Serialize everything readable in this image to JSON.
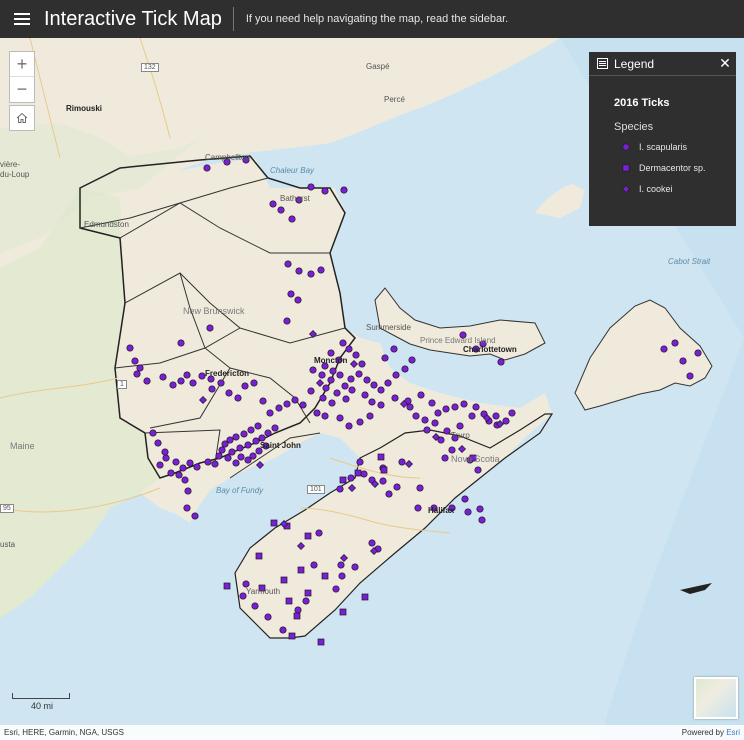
{
  "header": {
    "title": "Interactive Tick Map",
    "subtitle": "If you need help navigating the map, read the sidebar."
  },
  "controls": {
    "zoom_in": "+",
    "zoom_out": "−",
    "home_icon": "home-icon",
    "menu_icon": "hamburger-menu-icon"
  },
  "legend": {
    "title": "Legend",
    "layer": "2016 Ticks",
    "field": "Species",
    "items": [
      {
        "label": "I. scapularis",
        "symbol": "circle",
        "color": "#7b1fd6"
      },
      {
        "label": "Dermacentor sp.",
        "symbol": "square",
        "color": "#7b1fd6"
      },
      {
        "label": "I. cookei",
        "symbol": "diamond",
        "color": "#7b1fd6"
      }
    ]
  },
  "map_labels": {
    "gaspe": "Gaspé",
    "perce": "Percé",
    "rimouski": "Rimouski",
    "riviere1": "vière-",
    "riviere2": "du-Loup",
    "campbellton": "Campbellton",
    "bathurst": "Bathurst",
    "edmundston": "Edmundston",
    "new_brunswick": "New Brunswick",
    "fredericton": "Fredericton",
    "moncton": "Moncton",
    "saint_john": "Saint John",
    "summerside": "Summerside",
    "pei": "Prince Edward Island",
    "charlottetown": "Charlottetown",
    "truro": "Truro",
    "nova_scotia": "Nova Scotia",
    "halifax": "Halifax",
    "yarmouth": "Yarmouth",
    "maine": "Maine",
    "augusta": "usta",
    "chaleur_bay": "Chaleur Bay",
    "bay_of_fundy": "Bay of Fundy",
    "cabot_strait": "Cabot Strait",
    "shield_132": "132",
    "shield_1": "1",
    "shield_101": "101",
    "shield_95": "95"
  },
  "scale": {
    "label": "40 mi"
  },
  "attribution": {
    "text": "Esri, HERE, Garmin, NGA, USGS",
    "powered_prefix": "Powered by ",
    "powered_link": "Esri"
  },
  "colors": {
    "point_fill": "#7b1fd6",
    "land": "#efeadb",
    "land_green": "#dfe8cf",
    "water": "#cfe6f2",
    "header_bg": "#2f2f2f"
  },
  "tick_points": {
    "circles": [
      [
        207,
        130
      ],
      [
        227,
        124
      ],
      [
        246,
        122
      ],
      [
        273,
        166
      ],
      [
        281,
        172
      ],
      [
        292,
        181
      ],
      [
        299,
        162
      ],
      [
        311,
        149
      ],
      [
        325,
        153
      ],
      [
        344,
        152
      ],
      [
        288,
        226
      ],
      [
        299,
        233
      ],
      [
        311,
        236
      ],
      [
        321,
        232
      ],
      [
        291,
        256
      ],
      [
        298,
        262
      ],
      [
        287,
        283
      ],
      [
        181,
        305
      ],
      [
        210,
        290
      ],
      [
        130,
        310
      ],
      [
        135,
        323
      ],
      [
        140,
        330
      ],
      [
        137,
        336
      ],
      [
        147,
        343
      ],
      [
        163,
        339
      ],
      [
        173,
        347
      ],
      [
        181,
        343
      ],
      [
        187,
        337
      ],
      [
        193,
        345
      ],
      [
        202,
        338
      ],
      [
        211,
        341
      ],
      [
        212,
        351
      ],
      [
        221,
        345
      ],
      [
        229,
        355
      ],
      [
        238,
        360
      ],
      [
        245,
        348
      ],
      [
        254,
        345
      ],
      [
        263,
        363
      ],
      [
        270,
        375
      ],
      [
        279,
        370
      ],
      [
        287,
        366
      ],
      [
        295,
        362
      ],
      [
        303,
        367
      ],
      [
        268,
        395
      ],
      [
        275,
        390
      ],
      [
        258,
        388
      ],
      [
        251,
        392
      ],
      [
        244,
        396
      ],
      [
        236,
        399
      ],
      [
        230,
        402
      ],
      [
        225,
        406
      ],
      [
        222,
        412
      ],
      [
        232,
        414
      ],
      [
        240,
        410
      ],
      [
        248,
        407
      ],
      [
        256,
        403
      ],
      [
        262,
        400
      ],
      [
        266,
        408
      ],
      [
        259,
        413
      ],
      [
        253,
        418
      ],
      [
        248,
        422
      ],
      [
        241,
        419
      ],
      [
        236,
        425
      ],
      [
        228,
        420
      ],
      [
        219,
        418
      ],
      [
        215,
        426
      ],
      [
        208,
        424
      ],
      [
        197,
        429
      ],
      [
        190,
        425
      ],
      [
        183,
        430
      ],
      [
        176,
        424
      ],
      [
        166,
        420
      ],
      [
        160,
        427
      ],
      [
        171,
        435
      ],
      [
        179,
        437
      ],
      [
        185,
        442
      ],
      [
        188,
        453
      ],
      [
        165,
        414
      ],
      [
        158,
        405
      ],
      [
        153,
        395
      ],
      [
        187,
        470
      ],
      [
        195,
        478
      ],
      [
        313,
        332
      ],
      [
        322,
        337
      ],
      [
        331,
        342
      ],
      [
        326,
        350
      ],
      [
        337,
        355
      ],
      [
        345,
        348
      ],
      [
        351,
        341
      ],
      [
        359,
        336
      ],
      [
        367,
        342
      ],
      [
        374,
        347
      ],
      [
        381,
        352
      ],
      [
        388,
        345
      ],
      [
        396,
        337
      ],
      [
        405,
        331
      ],
      [
        412,
        322
      ],
      [
        343,
        305
      ],
      [
        349,
        311
      ],
      [
        356,
        317
      ],
      [
        362,
        326
      ],
      [
        339,
        322
      ],
      [
        331,
        315
      ],
      [
        325,
        328
      ],
      [
        333,
        333
      ],
      [
        340,
        337
      ],
      [
        352,
        352
      ],
      [
        346,
        361
      ],
      [
        365,
        357
      ],
      [
        372,
        364
      ],
      [
        381,
        367
      ],
      [
        370,
        378
      ],
      [
        360,
        384
      ],
      [
        349,
        388
      ],
      [
        340,
        380
      ],
      [
        317,
        375
      ],
      [
        325,
        378
      ],
      [
        332,
        365
      ],
      [
        323,
        360
      ],
      [
        311,
        353
      ],
      [
        385,
        320
      ],
      [
        394,
        311
      ],
      [
        463,
        297
      ],
      [
        483,
        306
      ],
      [
        501,
        324
      ],
      [
        476,
        311
      ],
      [
        395,
        360
      ],
      [
        408,
        363
      ],
      [
        421,
        357
      ],
      [
        432,
        365
      ],
      [
        438,
        375
      ],
      [
        446,
        371
      ],
      [
        455,
        369
      ],
      [
        464,
        366
      ],
      [
        476,
        369
      ],
      [
        484,
        376
      ],
      [
        489,
        383
      ],
      [
        497,
        387
      ],
      [
        506,
        383
      ],
      [
        512,
        375
      ],
      [
        496,
        378
      ],
      [
        472,
        378
      ],
      [
        460,
        388
      ],
      [
        447,
        393
      ],
      [
        435,
        385
      ],
      [
        425,
        382
      ],
      [
        416,
        378
      ],
      [
        427,
        392
      ],
      [
        441,
        402
      ],
      [
        455,
        400
      ],
      [
        452,
        412
      ],
      [
        445,
        420
      ],
      [
        470,
        422
      ],
      [
        478,
        432
      ],
      [
        410,
        369
      ],
      [
        402,
        424
      ],
      [
        383,
        430
      ],
      [
        360,
        424
      ],
      [
        364,
        436
      ],
      [
        372,
        442
      ],
      [
        383,
        443
      ],
      [
        340,
        451
      ],
      [
        351,
        440
      ],
      [
        418,
        470
      ],
      [
        434,
        470
      ],
      [
        452,
        470
      ],
      [
        468,
        474
      ],
      [
        480,
        471
      ],
      [
        482,
        482
      ],
      [
        465,
        461
      ],
      [
        420,
        450
      ],
      [
        397,
        449
      ],
      [
        389,
        456
      ],
      [
        372,
        505
      ],
      [
        378,
        511
      ],
      [
        342,
        538
      ],
      [
        336,
        551
      ],
      [
        306,
        563
      ],
      [
        298,
        572
      ],
      [
        246,
        546
      ],
      [
        243,
        558
      ],
      [
        255,
        568
      ],
      [
        268,
        579
      ],
      [
        283,
        592
      ],
      [
        314,
        527
      ],
      [
        319,
        495
      ],
      [
        341,
        527
      ],
      [
        355,
        529
      ],
      [
        698,
        315
      ],
      [
        683,
        323
      ],
      [
        690,
        338
      ],
      [
        664,
        311
      ],
      [
        675,
        305
      ]
    ],
    "squares": [
      [
        274,
        485
      ],
      [
        287,
        488
      ],
      [
        308,
        498
      ],
      [
        343,
        442
      ],
      [
        358,
        435
      ],
      [
        384,
        432
      ],
      [
        473,
        420
      ],
      [
        381,
        419
      ],
      [
        259,
        518
      ],
      [
        284,
        542
      ],
      [
        262,
        550
      ],
      [
        301,
        532
      ],
      [
        325,
        538
      ],
      [
        308,
        555
      ],
      [
        289,
        563
      ],
      [
        297,
        578
      ],
      [
        321,
        604
      ],
      [
        343,
        574
      ],
      [
        365,
        559
      ],
      [
        292,
        598
      ],
      [
        227,
        548
      ]
    ],
    "diamonds": [
      [
        203,
        362
      ],
      [
        260,
        427
      ],
      [
        313,
        296
      ],
      [
        320,
        345
      ],
      [
        354,
        326
      ],
      [
        404,
        366
      ],
      [
        436,
        399
      ],
      [
        462,
        411
      ],
      [
        487,
        380
      ],
      [
        500,
        386
      ],
      [
        409,
        426
      ],
      [
        375,
        446
      ],
      [
        352,
        450
      ],
      [
        284,
        486
      ],
      [
        301,
        508
      ],
      [
        344,
        520
      ],
      [
        374,
        513
      ]
    ]
  }
}
